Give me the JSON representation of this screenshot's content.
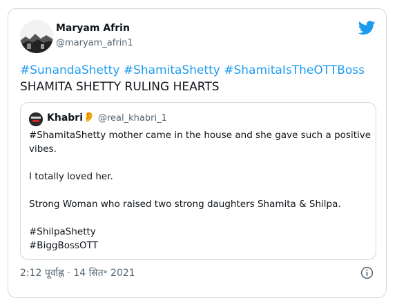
{
  "author": {
    "name": "Maryam Afrin",
    "handle": "@maryam_afrin1"
  },
  "tweet": {
    "hashtags": [
      "#SunandaShetty",
      "#ShamitaShetty",
      "#ShamitaIsTheOTTBoss"
    ],
    "text": "SHAMITA SHETTY RULING HEARTS"
  },
  "quoted_tweet": {
    "name": "Khabri",
    "name_emoji": "👂",
    "handle": "@real_khabri_1",
    "lines": [
      "#ShamitaShetty mother came in the house and she gave such a positive",
      "vibes.",
      "I totally loved her.",
      "Strong Woman who raised two strong daughters Shamita & Shilpa.",
      "#ShilpaShetty",
      "#BiggBossOTT"
    ]
  },
  "timestamp": "2:12 पूर्वाह्न · 14 सित॰ 2021",
  "colors": {
    "accent": "#1d9bf0",
    "text": "#0f1419",
    "secondary": "#536471",
    "border": "#cfd9de"
  },
  "icons": {
    "brand": "twitter-bird-icon",
    "info": "info-circle-icon"
  }
}
